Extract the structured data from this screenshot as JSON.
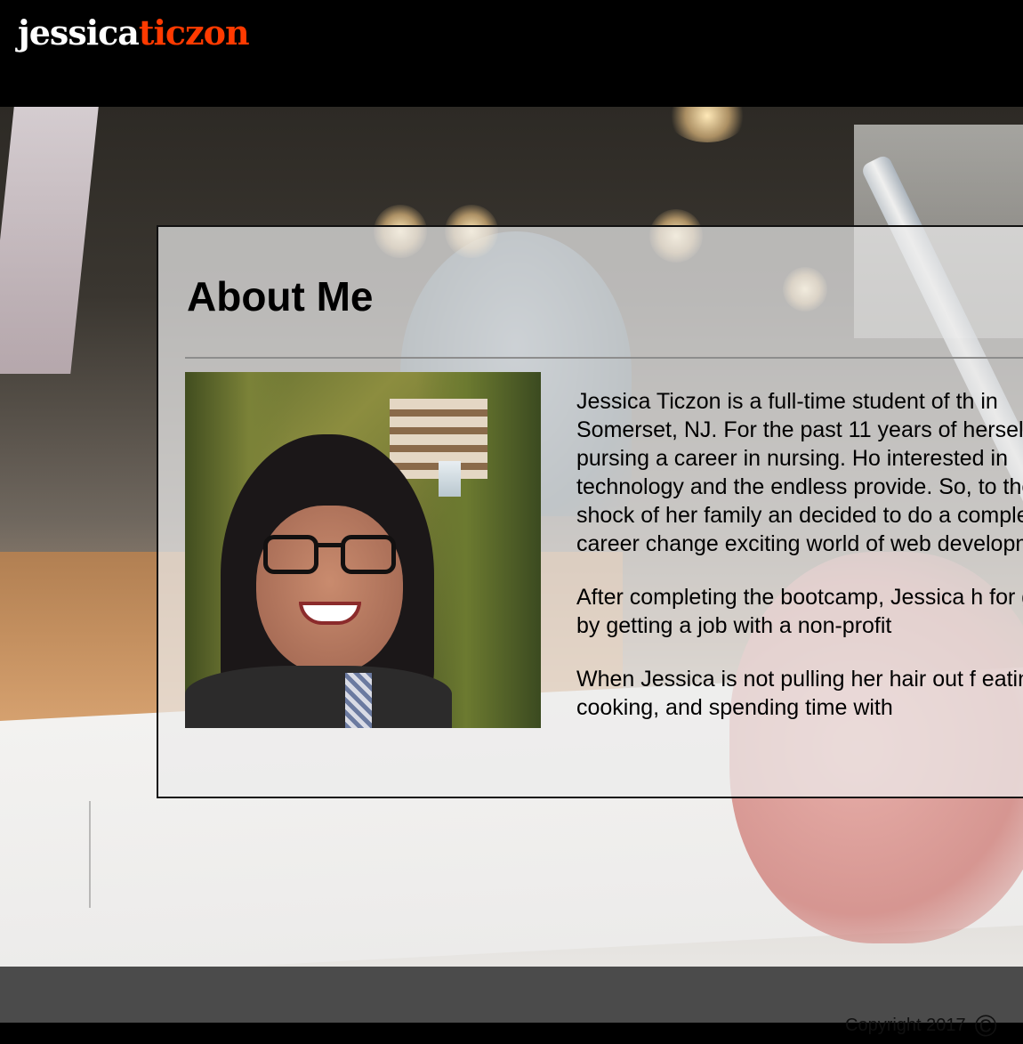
{
  "header": {
    "logo_first": "jessica",
    "logo_last": "ticzon"
  },
  "about": {
    "title": "About Me",
    "photo_alt": "Jessica Ticzon smiling in front of Fallingwater",
    "paragraphs": [
      "Jessica Ticzon is a full-time student of th in Somerset, NJ. For the past 11 years of herself to pursing a career in nursing. Ho interested in technology and the endless provide. So, to the shock of her family an decided to do a complete career change exciting world of web development!",
      "After completing the bootcamp, Jessica h for good by getting a job with a non-profit",
      "When Jessica is not pulling her hair out f eating, cooking, and spending time with"
    ]
  },
  "footer": {
    "copyright_text": "Copyright 2017",
    "copyright_symbol": "©"
  },
  "colors": {
    "logo_first": "#ffffff",
    "logo_last": "#ff3a00",
    "header_bg": "#000000",
    "footer_bg": "#4b4b4b"
  }
}
